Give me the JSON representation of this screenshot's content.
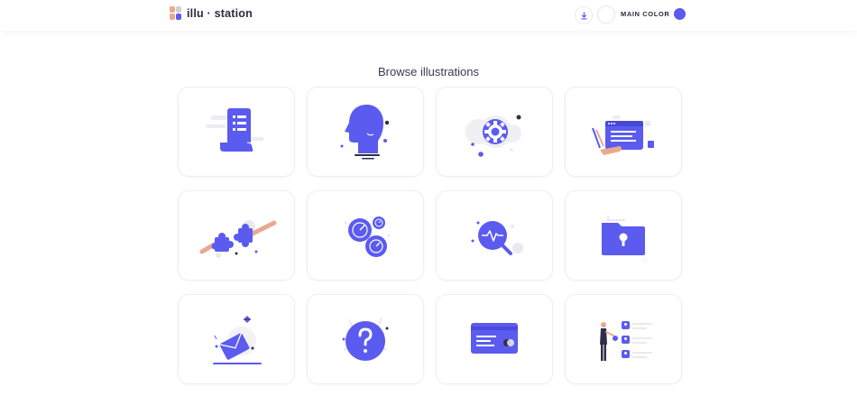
{
  "header": {
    "logo_text": "illu · station",
    "main_color_label": "MAIN COLOR",
    "main_color": "#5b5bf0"
  },
  "page": {
    "heading": "Browse illustrations"
  },
  "illustrations": [
    {
      "icon": "document-list-icon"
    },
    {
      "icon": "head-profile-icon"
    },
    {
      "icon": "gear-settings-icon"
    },
    {
      "icon": "browser-window-icon"
    },
    {
      "icon": "puzzle-pieces-icon"
    },
    {
      "icon": "gauges-icon"
    },
    {
      "icon": "magnifier-pulse-icon"
    },
    {
      "icon": "locked-folder-icon"
    },
    {
      "icon": "envelope-icon"
    },
    {
      "icon": "question-mark-icon"
    },
    {
      "icon": "credit-card-icon"
    },
    {
      "icon": "presentation-person-icon"
    }
  ],
  "colors": {
    "accent": "#5b5bf0",
    "muted_gray": "#e9e9ef",
    "skin": "#e8a98f",
    "dark": "#2e2e48"
  }
}
